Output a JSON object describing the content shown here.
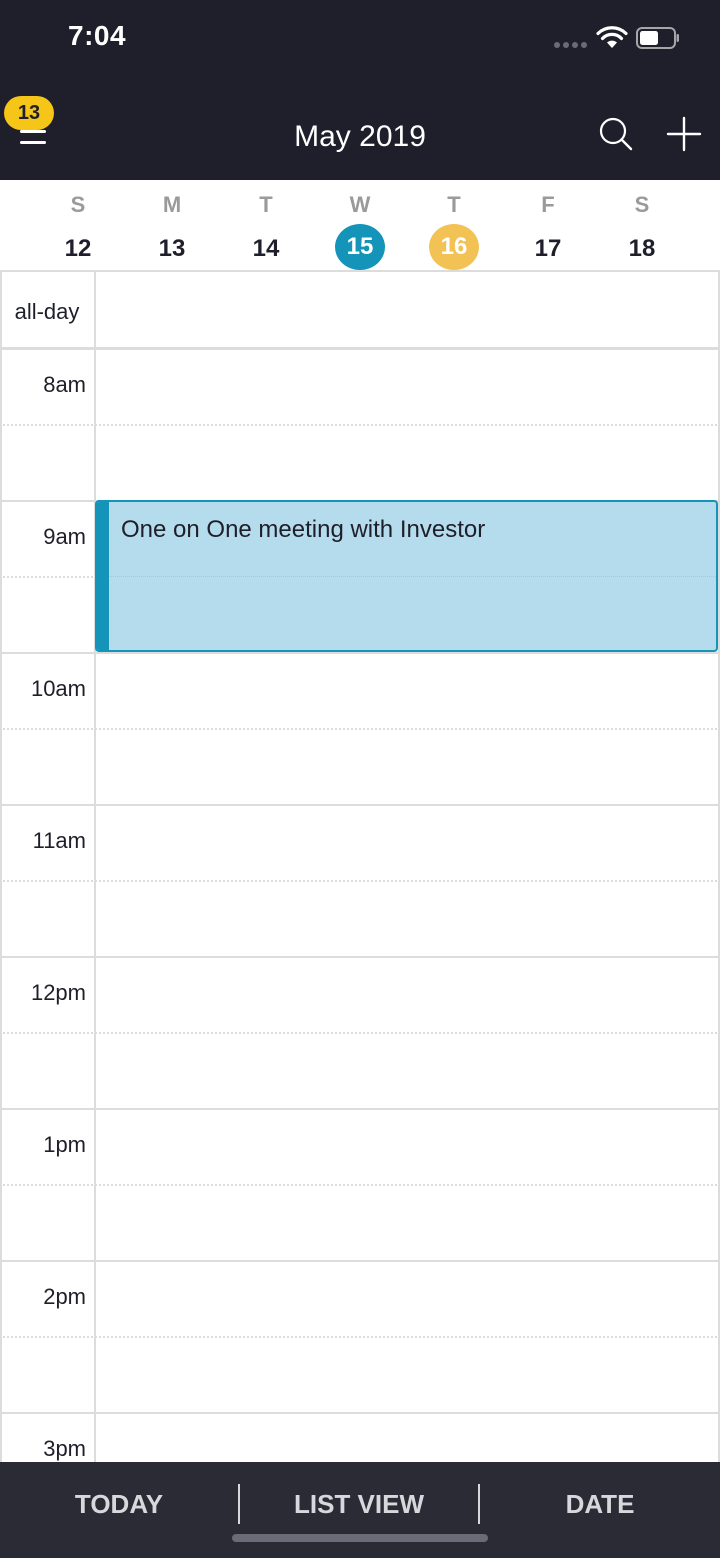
{
  "status_bar": {
    "time": "7:04"
  },
  "header": {
    "title": "May 2019",
    "badge_count": "13",
    "icons": {
      "menu": "hamburger-menu-icon",
      "search": "search-icon",
      "add": "plus-icon"
    }
  },
  "week": {
    "days": [
      {
        "letter": "S",
        "number": "12"
      },
      {
        "letter": "M",
        "number": "13"
      },
      {
        "letter": "T",
        "number": "14"
      },
      {
        "letter": "W",
        "number": "15"
      },
      {
        "letter": "T",
        "number": "16"
      },
      {
        "letter": "F",
        "number": "17"
      },
      {
        "letter": "S",
        "number": "18"
      }
    ],
    "selected_number": "15",
    "today_number": "16"
  },
  "grid": {
    "allday_label": "all-day",
    "hours": [
      "8am",
      "9am",
      "10am",
      "11am",
      "12pm",
      "1pm",
      "2pm",
      "3pm"
    ]
  },
  "event": {
    "title": "One on One meeting with Investor",
    "start": "9am",
    "end": "10am"
  },
  "bottom_bar": {
    "today_label": "TODAY",
    "list_view_label": "LIST VIEW",
    "date_label": "DATE"
  },
  "colors": {
    "header_bg": "#1f1f2b",
    "accent_blue": "#1494b8",
    "today_yellow": "#f2c254",
    "badge_yellow": "#f5c518",
    "event_fill": "#b5dcec",
    "bottom_bar_bg": "#2b2b36"
  }
}
